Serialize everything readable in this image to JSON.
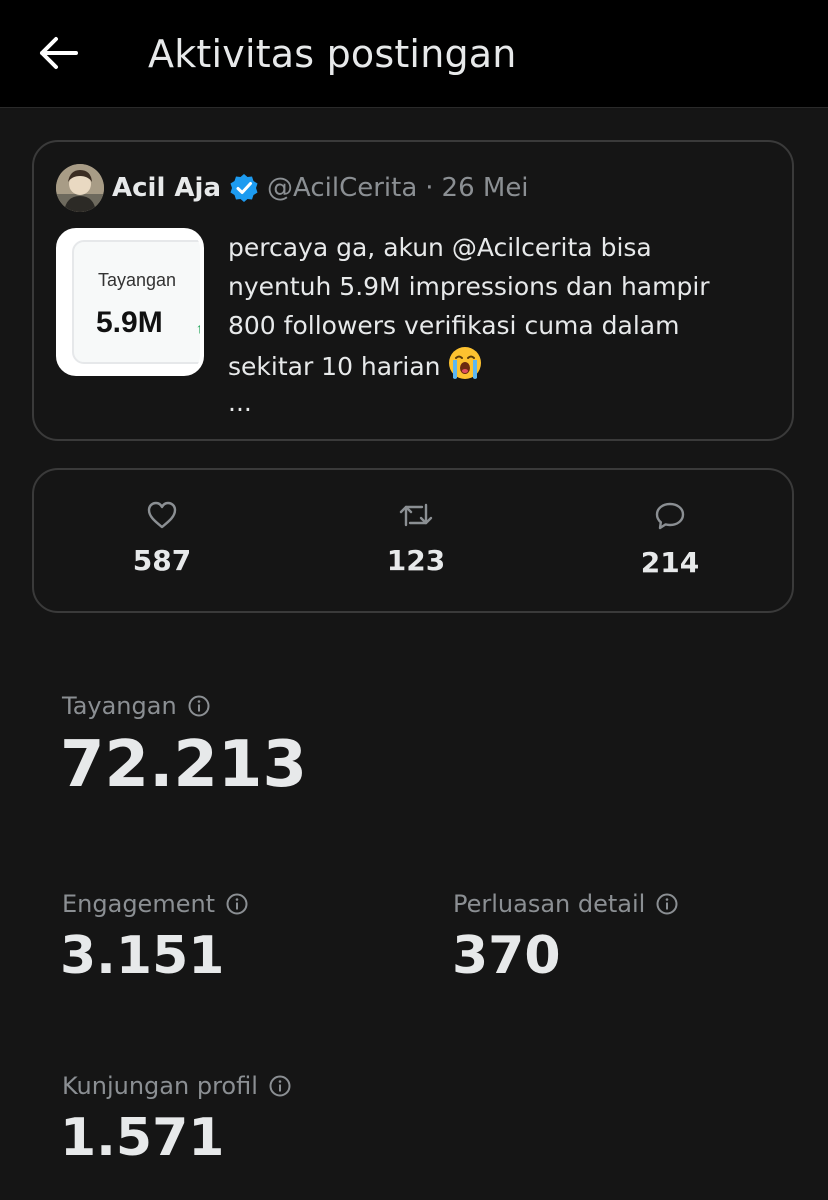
{
  "header": {
    "title": "Aktivitas postingan",
    "back_icon": "arrow-left-icon"
  },
  "post": {
    "author_name": "Acil Aja",
    "verified_icon": "verified-badge-icon",
    "handle": "@AcilCerita",
    "separator": "·",
    "date": "26 Mei",
    "thumbnail": {
      "label": "Tayangan",
      "value": "5.9M",
      "arrow": "↑"
    },
    "text_lines": [
      "percaya ga, akun @Acilcerita bisa",
      "nyentuh 5.9M impressions dan hampir",
      "800 followers verifikasi cuma dalam",
      "sekitar 10 harian"
    ],
    "emoji": "loudly-crying-face-emoji",
    "ellipsis": "..."
  },
  "engagement_bar": {
    "likes": {
      "icon": "heart-icon",
      "value": "587"
    },
    "reposts": {
      "icon": "repost-icon",
      "value": "123"
    },
    "replies": {
      "icon": "reply-icon",
      "value": "214"
    }
  },
  "metrics": {
    "views": {
      "label": "Tayangan",
      "value": "72.213"
    },
    "engagement": {
      "label": "Engagement",
      "value": "3.151"
    },
    "detail_expands": {
      "label": "Perluasan detail",
      "value": "370"
    },
    "profile_visits": {
      "label": "Kunjungan profil",
      "value": "1.571"
    }
  },
  "colors": {
    "background": "#151515",
    "header_bg": "#000000",
    "text_primary": "#e7e9ea",
    "text_secondary": "#8b8f93",
    "border": "#3a3a3a",
    "verified_blue": "#1d9bf0"
  }
}
